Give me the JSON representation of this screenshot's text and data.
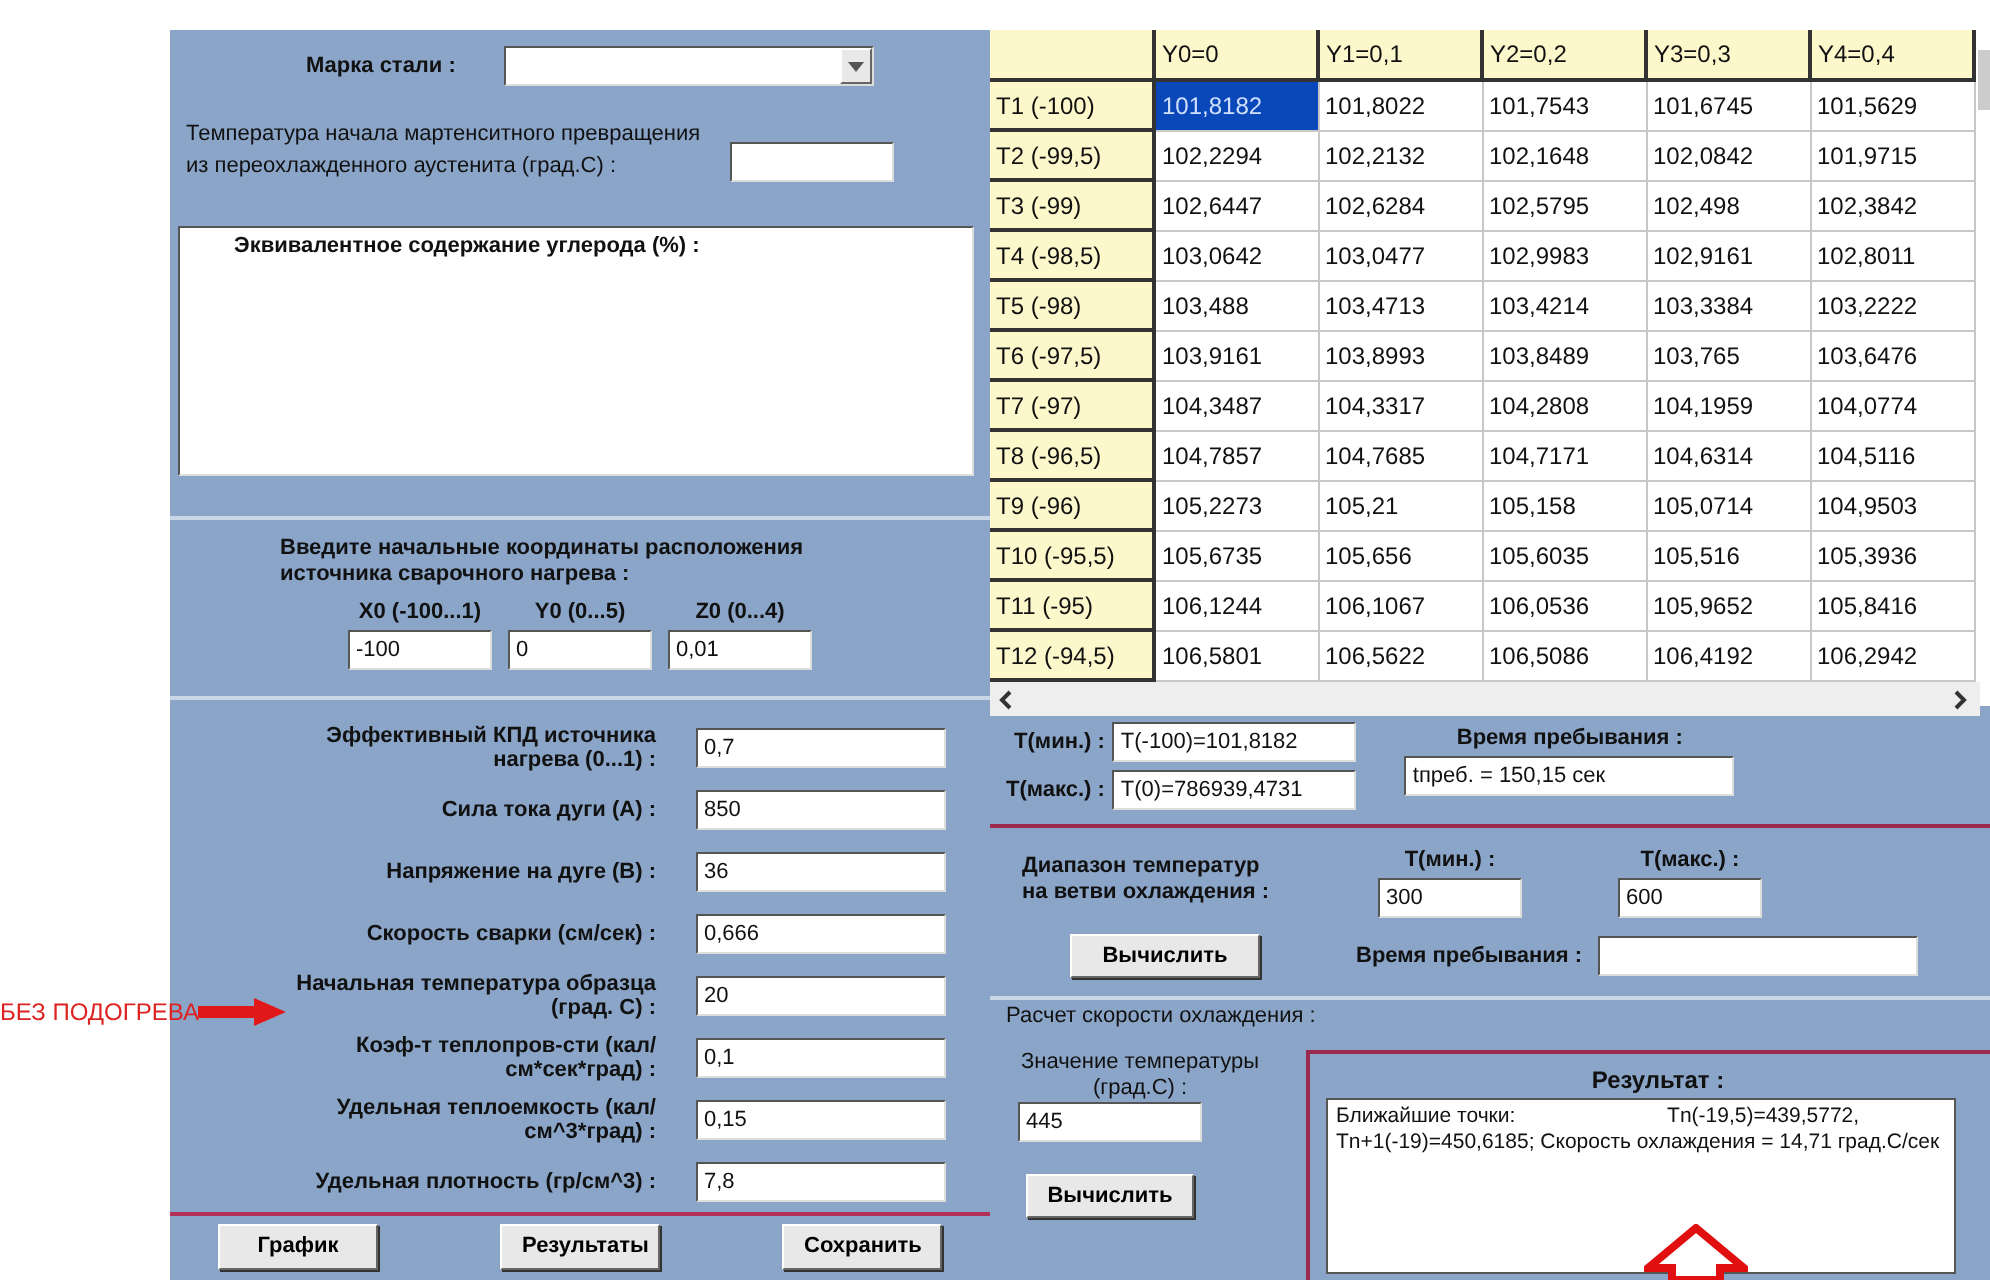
{
  "annotation": {
    "text": "БЕЗ ПОДОГРЕВА"
  },
  "steel_grade": {
    "label": "Марка стали :"
  },
  "martensite_temp": {
    "label": "Температура начала мартенситного превращения из переохлажденного аустенита (град.С) :"
  },
  "carbon": {
    "label": "Эквивалентное содержание углерода (%) :"
  },
  "coords": {
    "label": "Введите начальные координаты расположения источника сварочного нагрева :",
    "fields": [
      {
        "label": "X0 (-100...1)",
        "value": "-100"
      },
      {
        "label": "Y0 (0...5)",
        "value": "0"
      },
      {
        "label": "Z0 (0...4)",
        "value": "0,01"
      }
    ]
  },
  "params": [
    {
      "label": "Эффективный КПД источника нагрева (0...1) :",
      "value": "0,7"
    },
    {
      "label": "Сила тока дуги (А) :",
      "value": "850"
    },
    {
      "label": "Напряжение на дуге (В) :",
      "value": "36"
    },
    {
      "label": "Скорость сварки (см/сек) :",
      "value": "0,666"
    },
    {
      "label": "Начальная температура образца (град. С) :",
      "value": "20"
    },
    {
      "label": "Коэф-т теплопров-сти (кал/см*сек*град) :",
      "value": "0,1"
    },
    {
      "label": "Удельная теплоемкость (кал/см^3*град) :",
      "value": "0,15"
    },
    {
      "label": "Удельная плотность (гр/см^3) :",
      "value": "7,8"
    }
  ],
  "buttons": [
    "График",
    "Результаты",
    "Сохранить"
  ],
  "table": {
    "columns": [
      "Y0=0",
      "Y1=0,1",
      "Y2=0,2",
      "Y3=0,3",
      "Y4=0,4"
    ],
    "rows": [
      {
        "label": "T1 (-100)",
        "cells": [
          {
            "text": "101,8182",
            "selected": true
          },
          {
            "text": "101,8022",
            "selected": false
          },
          {
            "text": "101,7543",
            "selected": false
          },
          {
            "text": "101,6745",
            "selected": false
          },
          {
            "text": "101,5629",
            "selected": false
          }
        ]
      },
      {
        "label": "T2 (-99,5)",
        "cells": [
          {
            "text": "102,2294",
            "selected": false
          },
          {
            "text": "102,2132",
            "selected": false
          },
          {
            "text": "102,1648",
            "selected": false
          },
          {
            "text": "102,0842",
            "selected": false
          },
          {
            "text": "101,9715",
            "selected": false
          }
        ]
      },
      {
        "label": "T3 (-99)",
        "cells": [
          {
            "text": "102,6447",
            "selected": false
          },
          {
            "text": "102,6284",
            "selected": false
          },
          {
            "text": "102,5795",
            "selected": false
          },
          {
            "text": "102,498",
            "selected": false
          },
          {
            "text": "102,3842",
            "selected": false
          }
        ]
      },
      {
        "label": "T4 (-98,5)",
        "cells": [
          {
            "text": "103,0642",
            "selected": false
          },
          {
            "text": "103,0477",
            "selected": false
          },
          {
            "text": "102,9983",
            "selected": false
          },
          {
            "text": "102,9161",
            "selected": false
          },
          {
            "text": "102,8011",
            "selected": false
          }
        ]
      },
      {
        "label": "T5 (-98)",
        "cells": [
          {
            "text": "103,488",
            "selected": false
          },
          {
            "text": "103,4713",
            "selected": false
          },
          {
            "text": "103,4214",
            "selected": false
          },
          {
            "text": "103,3384",
            "selected": false
          },
          {
            "text": "103,2222",
            "selected": false
          }
        ]
      },
      {
        "label": "T6 (-97,5)",
        "cells": [
          {
            "text": "103,9161",
            "selected": false
          },
          {
            "text": "103,8993",
            "selected": false
          },
          {
            "text": "103,8489",
            "selected": false
          },
          {
            "text": "103,765",
            "selected": false
          },
          {
            "text": "103,6476",
            "selected": false
          }
        ]
      },
      {
        "label": "T7 (-97)",
        "cells": [
          {
            "text": "104,3487",
            "selected": false
          },
          {
            "text": "104,3317",
            "selected": false
          },
          {
            "text": "104,2808",
            "selected": false
          },
          {
            "text": "104,1959",
            "selected": false
          },
          {
            "text": "104,0774",
            "selected": false
          }
        ]
      },
      {
        "label": "T8 (-96,5)",
        "cells": [
          {
            "text": "104,7857",
            "selected": false
          },
          {
            "text": "104,7685",
            "selected": false
          },
          {
            "text": "104,7171",
            "selected": false
          },
          {
            "text": "104,6314",
            "selected": false
          },
          {
            "text": "104,5116",
            "selected": false
          }
        ]
      },
      {
        "label": "T9 (-96)",
        "cells": [
          {
            "text": "105,2273",
            "selected": false
          },
          {
            "text": "105,21",
            "selected": false
          },
          {
            "text": "105,158",
            "selected": false
          },
          {
            "text": "105,0714",
            "selected": false
          },
          {
            "text": "104,9503",
            "selected": false
          }
        ]
      },
      {
        "label": "T10 (-95,5)",
        "cells": [
          {
            "text": "105,6735",
            "selected": false
          },
          {
            "text": "105,656",
            "selected": false
          },
          {
            "text": "105,6035",
            "selected": false
          },
          {
            "text": "105,516",
            "selected": false
          },
          {
            "text": "105,3936",
            "selected": false
          }
        ]
      },
      {
        "label": "T11 (-95)",
        "cells": [
          {
            "text": "106,1244",
            "selected": false
          },
          {
            "text": "106,1067",
            "selected": false
          },
          {
            "text": "106,0536",
            "selected": false
          },
          {
            "text": "105,9652",
            "selected": false
          },
          {
            "text": "105,8416",
            "selected": false
          }
        ]
      },
      {
        "label": "T12 (-94,5)",
        "cells": [
          {
            "text": "106,5801",
            "selected": false
          },
          {
            "text": "106,5622",
            "selected": false
          },
          {
            "text": "106,5086",
            "selected": false
          },
          {
            "text": "106,4192",
            "selected": false
          },
          {
            "text": "106,2942",
            "selected": false
          }
        ]
      }
    ]
  },
  "extremes": {
    "min_label": "T(мин.) :",
    "min_value": "T(-100)=101,8182",
    "max_label": "T(макс.) :",
    "max_value": "T(0)=786939,4731",
    "time_label": "Время пребывания :",
    "time_value": "tпреб. = 150,15 сек"
  },
  "range": {
    "label": "Диапазон температур на ветви охлаждения :",
    "min_label": "T(мин.) :",
    "min_value": "300",
    "max_label": "T(макс.) :",
    "max_value": "600",
    "button": "Вычислить",
    "time_label": "Время пребывания :"
  },
  "cooling": {
    "title": "Расчет скорости охлаждения :",
    "temp_label": "Значение температуры (град.С) :",
    "temp_value": "445",
    "button": "Вычислить",
    "result_title": "Результат :",
    "result_text": "Ближайшие точки:                          Tn(-19,5)=439,5772, Tn+1(-19)=450,6185; Скорость охлаждения = 14,71 град.C/сек"
  }
}
